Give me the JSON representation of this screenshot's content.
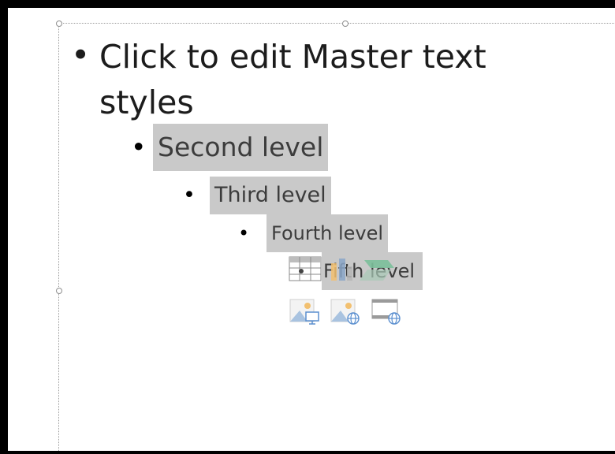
{
  "levels": {
    "first_line1": "Click to edit Master text",
    "first_line2": "styles",
    "second": "Second level",
    "third": "Third level",
    "fourth": "Fourth level",
    "fifth": "Fifth level"
  },
  "bullet_char": "•",
  "icons": [
    "table-icon",
    "chart-icon",
    "smartart-icon",
    "picture-icon",
    "online-picture-icon",
    "video-icon"
  ]
}
